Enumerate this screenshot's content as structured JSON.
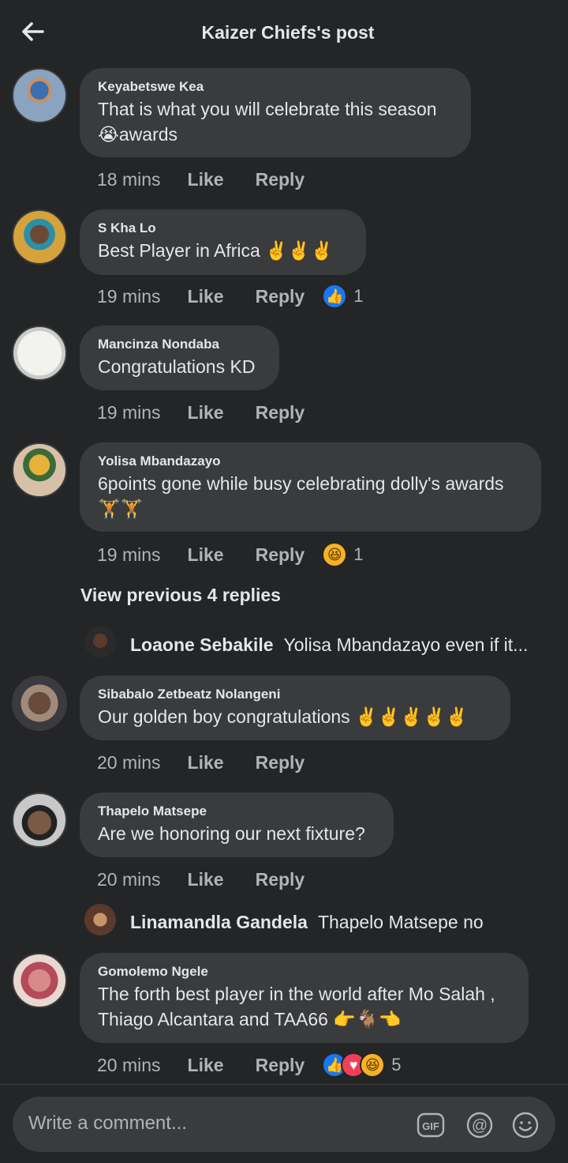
{
  "header": {
    "title": "Kaizer Chiefs's post"
  },
  "comments": [
    {
      "author": "Keyabetswe Kea",
      "text": "That is what you will celebrate this season 😭awards",
      "time": "18 mins",
      "like": "Like",
      "reply": "Reply"
    },
    {
      "author": "S Kha Lo",
      "text": "Best Player in Africa ✌️✌️✌️",
      "time": "19 mins",
      "like": "Like",
      "reply": "Reply",
      "reaction_count": "1"
    },
    {
      "author": "Mancinza Nondaba",
      "text": "Congratulations KD",
      "time": "19 mins",
      "like": "Like",
      "reply": "Reply"
    },
    {
      "author": "Yolisa Mbandazayo",
      "text": "6points gone while busy celebrating dolly's awards 🏋️🏋️",
      "time": "19 mins",
      "like": "Like",
      "reply": "Reply",
      "reaction_count": "1"
    },
    {
      "author": "Sibabalo Zetbeatz Nolangeni",
      "text": "Our golden boy congratulations ✌️✌️✌️✌️✌️",
      "time": "20 mins",
      "like": "Like",
      "reply": "Reply"
    },
    {
      "author": "Thapelo Matsepe",
      "text": "Are we honoring our next fixture?",
      "time": "20 mins",
      "like": "Like",
      "reply": "Reply"
    },
    {
      "author": "Gomolemo Ngele",
      "text": "The forth best player in the world after Mo Salah , Thiago Alcantara and TAA66 👉🐐👈",
      "time": "20 mins",
      "like": "Like",
      "reply": "Reply",
      "reaction_count": "5"
    }
  ],
  "view_previous": "View previous 4 replies",
  "replies": [
    {
      "author": "Loaone Sebakile",
      "text": "Yolisa Mbandazayo even if it..."
    },
    {
      "author": "Linamandla Gandela",
      "text": "Thapelo Matsepe no"
    }
  ],
  "composer": {
    "placeholder": "Write a comment..."
  },
  "icons": {
    "back": "arrow-left-icon",
    "like_reaction": "like-reaction-icon",
    "love_reaction": "love-reaction-icon",
    "haha_reaction": "haha-reaction-icon",
    "gif": "gif-icon",
    "mention": "at-icon",
    "emoji": "smiley-icon"
  },
  "colors": {
    "background": "#242526",
    "bubble": "#3a3b3c",
    "like_blue": "#1877f2",
    "love_red": "#f33e58",
    "haha_yellow": "#f7b125"
  }
}
